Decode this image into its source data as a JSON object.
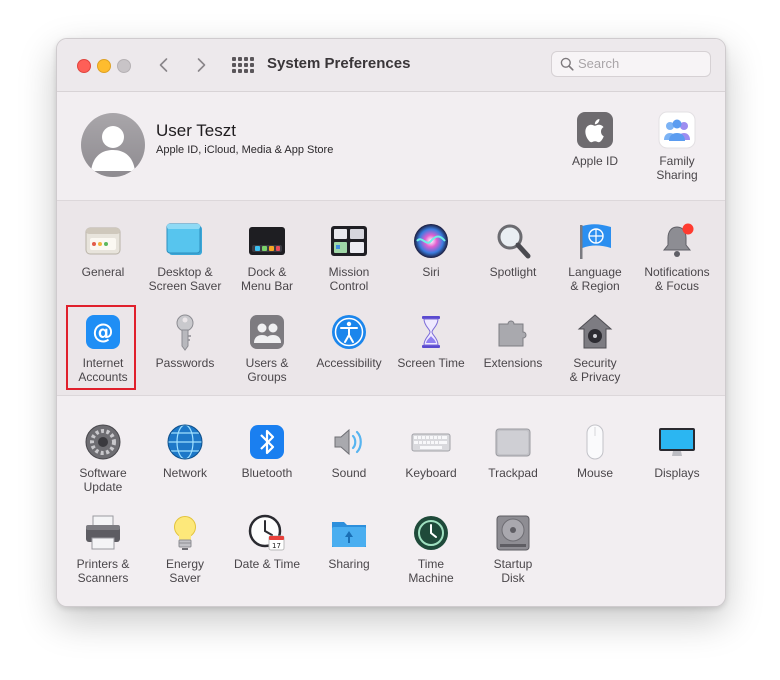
{
  "window": {
    "title": "System Preferences"
  },
  "search": {
    "placeholder": "Search"
  },
  "user": {
    "name": "User Teszt",
    "subtitle": "Apple ID, iCloud, Media & App Store"
  },
  "account_items": [
    {
      "label": "Apple ID",
      "icon": "apple-icon"
    },
    {
      "label": "Family\nSharing",
      "icon": "family-icon"
    }
  ],
  "section1": [
    {
      "label": "General",
      "icon": "general-icon"
    },
    {
      "label": "Desktop &\nScreen Saver",
      "icon": "desktop-icon"
    },
    {
      "label": "Dock &\nMenu Bar",
      "icon": "dock-icon"
    },
    {
      "label": "Mission\nControl",
      "icon": "mission-control-icon"
    },
    {
      "label": "Siri",
      "icon": "siri-icon"
    },
    {
      "label": "Spotlight",
      "icon": "spotlight-icon"
    },
    {
      "label": "Language\n& Region",
      "icon": "language-icon"
    },
    {
      "label": "Notifications\n& Focus",
      "icon": "notifications-icon"
    },
    {
      "label": "Internet\nAccounts",
      "icon": "internet-accounts-icon"
    },
    {
      "label": "Passwords",
      "icon": "key-icon"
    },
    {
      "label": "Users &\nGroups",
      "icon": "users-icon"
    },
    {
      "label": "Accessibility",
      "icon": "accessibility-icon"
    },
    {
      "label": "Screen Time",
      "icon": "hourglass-icon"
    },
    {
      "label": "Extensions",
      "icon": "puzzle-icon"
    },
    {
      "label": "Security\n& Privacy",
      "icon": "lock-house-icon"
    }
  ],
  "section2": [
    {
      "label": "Software\nUpdate",
      "icon": "gear-icon"
    },
    {
      "label": "Network",
      "icon": "globe-icon"
    },
    {
      "label": "Bluetooth",
      "icon": "bluetooth-icon"
    },
    {
      "label": "Sound",
      "icon": "speaker-icon"
    },
    {
      "label": "Keyboard",
      "icon": "keyboard-icon"
    },
    {
      "label": "Trackpad",
      "icon": "trackpad-icon"
    },
    {
      "label": "Mouse",
      "icon": "mouse-icon"
    },
    {
      "label": "Displays",
      "icon": "display-icon"
    },
    {
      "label": "Printers &\nScanners",
      "icon": "printer-icon"
    },
    {
      "label": "Energy\nSaver",
      "icon": "lightbulb-icon"
    },
    {
      "label": "Date & Time",
      "icon": "clock-icon"
    },
    {
      "label": "Sharing",
      "icon": "folder-icon"
    },
    {
      "label": "Time\nMachine",
      "icon": "time-machine-icon"
    },
    {
      "label": "Startup\nDisk",
      "icon": "disk-icon"
    }
  ],
  "highlight_color": "#e0202c"
}
